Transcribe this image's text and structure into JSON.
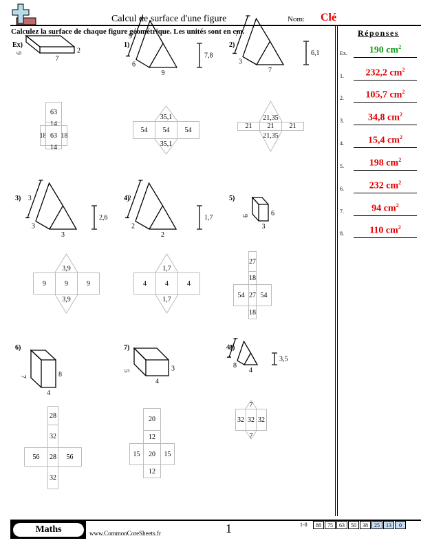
{
  "header": {
    "title": "Calcul de surface d'une figure",
    "name_label": "Nom:",
    "name_value": "Clé",
    "instructions": "Calculez la surface de chaque figure géométrique. Les unités sont en cm."
  },
  "answers": {
    "title": "Réponses",
    "unit": "cm",
    "unit_exp": "2",
    "items": [
      {
        "label": "Ex.",
        "value": "190"
      },
      {
        "label": "1.",
        "value": "232,2"
      },
      {
        "label": "2.",
        "value": "105,7"
      },
      {
        "label": "3.",
        "value": "34,8"
      },
      {
        "label": "4.",
        "value": "15,4"
      },
      {
        "label": "5.",
        "value": "198"
      },
      {
        "label": "6.",
        "value": "232"
      },
      {
        "label": "7.",
        "value": "94"
      },
      {
        "label": "8.",
        "value": "110"
      }
    ]
  },
  "problems": [
    {
      "label": "Ex)",
      "type": "rect-prism",
      "dims": {
        "depth": "9",
        "height": "2",
        "width": "7"
      },
      "net": {
        "top": "63",
        "strip_top": "14",
        "left": "18",
        "center": "63",
        "right": "18",
        "strip_bottom": "14"
      }
    },
    {
      "label": "1)",
      "type": "tri-prism",
      "dims": {
        "length": "9",
        "side": "6",
        "base": "9",
        "height": "7,8"
      },
      "net": {
        "top_tri": "35,1",
        "left": "54",
        "center": "54",
        "right": "54",
        "bottom_tri": "35,1"
      }
    },
    {
      "label": "2)",
      "type": "tri-prism",
      "dims": {
        "length": "7",
        "side": "3",
        "base": "7",
        "height": "6,1"
      },
      "net": {
        "top_tri": "21,35",
        "left": "21",
        "center": "21",
        "right": "21",
        "bottom_tri": "21,35"
      }
    },
    {
      "label": "3)",
      "type": "tri-prism",
      "dims": {
        "length": "3",
        "side": "3",
        "base": "3",
        "height": "2,6"
      },
      "net": {
        "top_tri": "3,9",
        "left": "9",
        "center": "9",
        "right": "9",
        "bottom_tri": "3,9"
      }
    },
    {
      "label": "4)",
      "type": "tri-prism",
      "dims": {
        "length": "2",
        "side": "2",
        "base": "2",
        "height": "1,7"
      },
      "net": {
        "top_tri": "1,7",
        "left": "4",
        "center": "4",
        "right": "4",
        "bottom_tri": "1,7"
      }
    },
    {
      "label": "5)",
      "type": "rect-prism",
      "dims": {
        "depth": "9",
        "height": "6",
        "width": "3"
      },
      "net": {
        "top": "27",
        "strip_top": "18",
        "left": "54",
        "center": "27",
        "right": "54",
        "strip_bottom": "18"
      }
    },
    {
      "label": "6)",
      "type": "rect-prism",
      "dims": {
        "depth": "7",
        "height": "8",
        "width": "4"
      },
      "net": {
        "top": "28",
        "strip_top": "32",
        "left": "56",
        "center": "28",
        "right": "56",
        "strip_bottom": "32"
      }
    },
    {
      "label": "7)",
      "type": "rect-prism",
      "dims": {
        "depth": "5",
        "height": "3",
        "width": "4"
      },
      "net": {
        "top": "20",
        "strip_top": "12",
        "left": "15",
        "center": "20",
        "right": "15",
        "strip_bottom": "12"
      }
    },
    {
      "label": "8)",
      "type": "tri-prism",
      "dims": {
        "length": "4",
        "side": "8",
        "base": "4",
        "height": "3,5"
      },
      "net": {
        "top_tri": "7",
        "left": "32",
        "center": "32",
        "right": "32",
        "bottom_tri": "7"
      }
    }
  ],
  "footer": {
    "subject": "Maths",
    "website": "www.CommonCoreSheets.fr",
    "page": "1",
    "score_label": "1-8",
    "scores": [
      "88",
      "75",
      "63",
      "50",
      "38",
      "25",
      "13",
      "0"
    ],
    "highlighted_scores": [
      "25",
      "13",
      "0"
    ]
  }
}
